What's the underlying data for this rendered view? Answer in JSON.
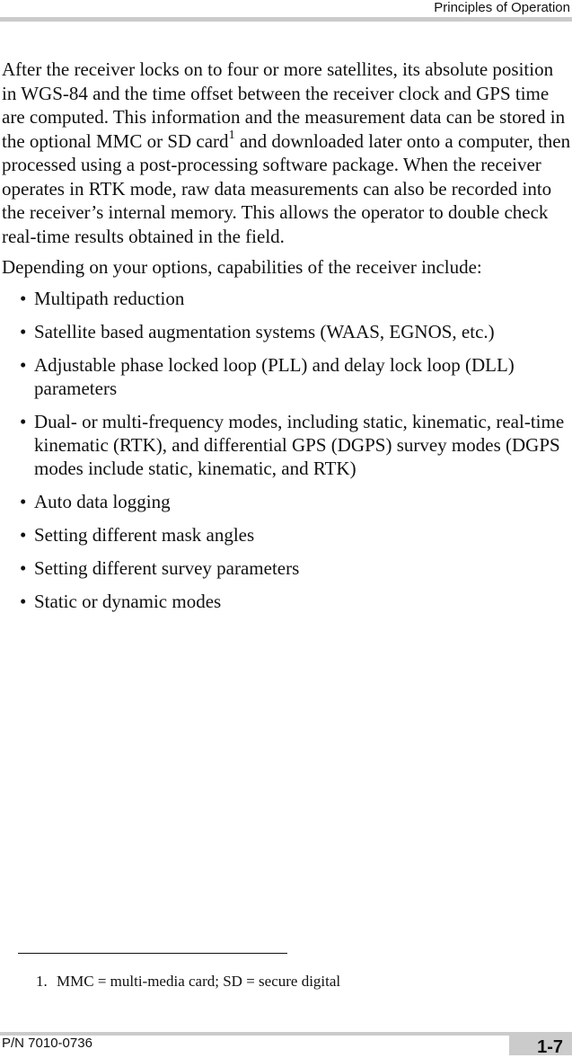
{
  "header": {
    "section_title": "Principles of Operation"
  },
  "body": {
    "paragraph1_part1": "After the receiver locks on to four or more satellites, its absolute position in WGS-84 and the time offset between the receiver clock and GPS time are computed. This information and the measurement data can be stored in the optional MMC or SD card",
    "paragraph1_footnote_ref": "1",
    "paragraph1_part2": " and downloaded later onto a computer, then processed using a post-processing software package. When the receiver operates in RTK mode, raw data measurements can also be recorded into the receiver’s internal memory. This allows the operator to double check real-time results obtained in the field.",
    "paragraph2": "Depending on your options, capabilities of the receiver include:",
    "bullet_glyph": "•",
    "bullets": [
      "Multipath reduction",
      "Satellite based augmentation systems (WAAS, EGNOS, etc.)",
      "Adjustable phase locked loop (PLL) and delay lock loop (DLL) parameters",
      "Dual- or multi-frequency modes, including static, kinematic, real-time kinematic (RTK), and differential GPS (DGPS) survey modes (DGPS modes include static, kinematic, and RTK)",
      "Auto data logging",
      "Setting different mask angles",
      "Setting different survey parameters",
      "Static or dynamic modes"
    ]
  },
  "footnote": {
    "number": "1.",
    "text": "MMC = multi-media card; SD = secure digital"
  },
  "footer": {
    "part_number": "P/N 7010-0736",
    "page_number": "1-7"
  }
}
